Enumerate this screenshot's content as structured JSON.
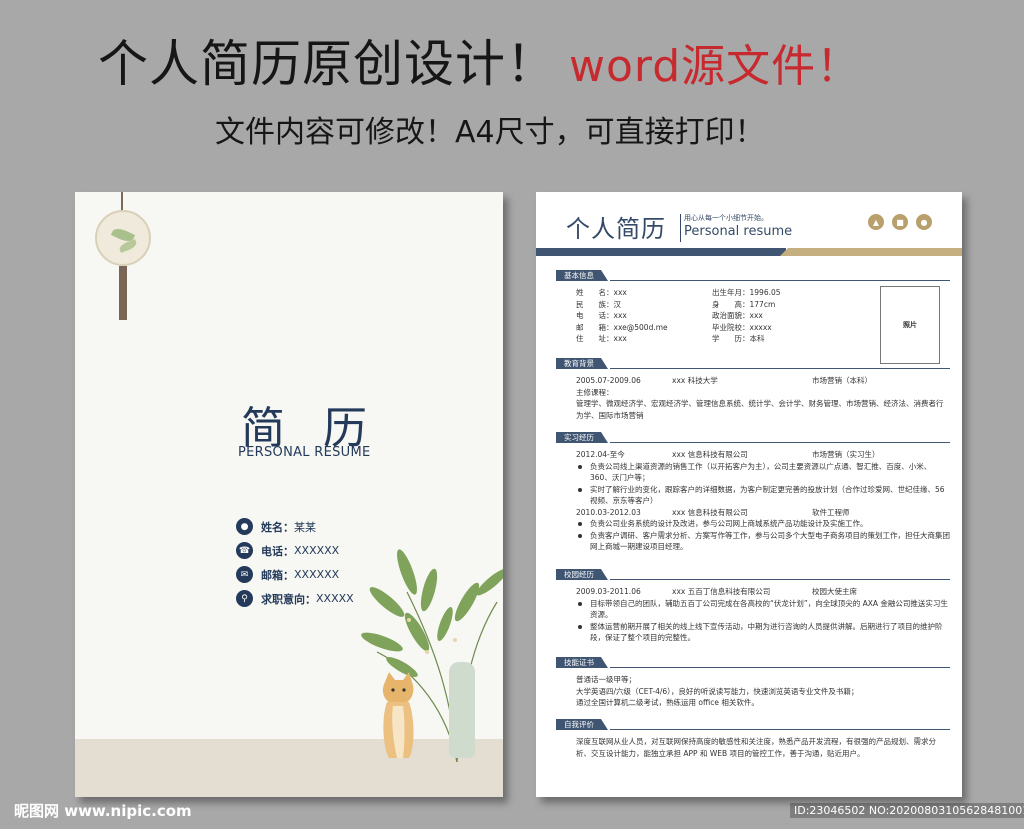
{
  "banner": {
    "title": "个人简历原创设计！",
    "title_red": "word源文件！",
    "subtitle": "文件内容可修改！A4尺寸，可直接打印！"
  },
  "cover": {
    "title": "简 历",
    "subtitle": "PERSONAL RESUME",
    "rows": [
      {
        "icon": "person-icon",
        "label": "姓名：",
        "value": "某某"
      },
      {
        "icon": "phone-icon",
        "label": "电话：",
        "value": "XXXXXX"
      },
      {
        "icon": "mail-icon",
        "label": "邮箱：",
        "value": "XXXXXX"
      },
      {
        "icon": "search-icon",
        "label": "求职意向：",
        "value": "XXXXX"
      }
    ]
  },
  "resume": {
    "title": "个人简历",
    "slogan": "用心从每一个小细节开始。",
    "subtitle": "Personal resume",
    "icons": [
      "graduation-cap-icon",
      "briefcase-icon",
      "lightbulb-icon"
    ],
    "photo_label": "照片",
    "sections": {
      "basic": {
        "title": "基本信息",
        "left": [
          "姓　　名：xxx",
          "民　　族：汉",
          "电　　话：xxx",
          "邮　　箱：xxe@500d.me",
          "住　　址：xxx"
        ],
        "right": [
          "出生年月：1996.05",
          "身　　高：177cm",
          "政治面貌：xxx",
          "毕业院校：xxxxx",
          "学　　历：本科"
        ]
      },
      "education": {
        "title": "教育背景",
        "date": "2005.07-2009.06",
        "school": "xxx 科技大学",
        "major": "市场营销（本科）",
        "course_label": "主修课程：",
        "courses": "管理学、微观经济学、宏观经济学、管理信息系统、统计学、会计学、财务管理、市场营销、经济法、消费者行为学、国际市场营销"
      },
      "intern": {
        "title": "实习经历",
        "jobs": [
          {
            "date": "2012.04-至今",
            "company": "xxx 信息科技有限公司",
            "role": "市场营销（实习生）",
            "bullets": [
              "负责公司线上渠道资源的销售工作（以开拓客户为主），公司主要资源以广点通、智汇推、百度、小米、360、沃门户等；",
              "实时了解行业的变化，跟踪客户的详细数据，为客户制定更完善的投放计划（合作过珍爱网、世纪佳缘、56视频、京东等客户）"
            ]
          },
          {
            "date": "2010.03-2012.03",
            "company": "xxx 信息科技有限公司",
            "role": "软件工程师",
            "bullets": [
              "负责公司业务系统的设计及改进，参与公司网上商城系统产品功能设计及实施工作。",
              "负责客户调研、客户需求分析、方案写作等工作，参与公司多个大型电子商务项目的策划工作，担任大商集团网上商城一期建设项目经理。"
            ]
          }
        ]
      },
      "campus": {
        "title": "校园经历",
        "date": "2009.03-2011.06",
        "org": "xxx 五百丁信息科技有限公司",
        "role": "校园大使主席",
        "bullets": [
          "目标带领自己的团队，辅助五百丁公司完成在各高校的“伏龙计划”，向全球顶尖的 AXA 金融公司推送实习生资源。",
          "整体运营前期开展了相关的线上线下宣传活动，中期为进行咨询的人员提供讲解。后期进行了项目的维护阶段，保证了整个项目的完整性。"
        ]
      },
      "skills": {
        "title": "技能证书",
        "lines": [
          "普通话一级甲等；",
          "大学英语四/六级（CET-4/6），良好的听说读写能力，快速浏览英语专业文件及书籍；",
          "通过全国计算机二级考试，熟练运用 office 相关软件。"
        ]
      },
      "self": {
        "title": "自我评价",
        "text": "深度互联网从业人员，对互联网保持高度的敏感性和关注度，熟悉产品开发流程，有很强的产品规划、需求分析、交互设计能力，能独立承担 APP 和 WEB 项目的管控工作，善于沟通，贴近用户。"
      }
    }
  },
  "watermark": "昵图网 www.nipic.com",
  "image_id": "ID:23046502 NO:20200803105628481001"
}
